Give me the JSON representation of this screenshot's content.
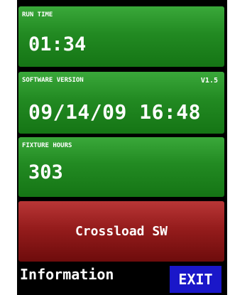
{
  "run_time": {
    "label": "RUN TIME",
    "value": "01:34"
  },
  "software_version": {
    "label": "SOFTWARE VERSION",
    "version": "V1.5",
    "value": "09/14/09 16:48"
  },
  "fixture_hours": {
    "label": "FIXTURE HOURS",
    "value": "303"
  },
  "crossload_button": {
    "label": "Crossload SW"
  },
  "footer": {
    "title": "Information",
    "exit_label": "EXIT"
  },
  "colors": {
    "panel_green": "#228a22",
    "button_red": "#951c1c",
    "exit_blue": "#1a17c9",
    "background": "#000000"
  }
}
